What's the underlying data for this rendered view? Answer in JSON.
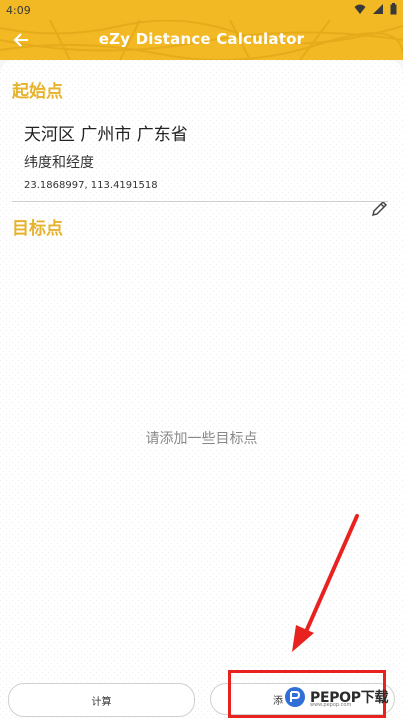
{
  "status_bar": {
    "time": "4:09"
  },
  "app_bar": {
    "title": "eZy Distance Calculator"
  },
  "start_point": {
    "section_title": "起始点",
    "address": "天河区 广州市 广东省",
    "coord_label": "纬度和经度",
    "coordinates": "23.1868997, 113.4191518"
  },
  "target_points": {
    "section_title": "目标点",
    "empty_text": "请添加一些目标点"
  },
  "bottom_buttons": {
    "calculate_label": "计算",
    "add_label": "添"
  },
  "watermark": {
    "text": "PEPOP下载",
    "subtext": "www.pepop.com"
  },
  "colors": {
    "accent": "#f2b924",
    "section_title": "#e7b22c",
    "annotation": "#e8231f"
  }
}
